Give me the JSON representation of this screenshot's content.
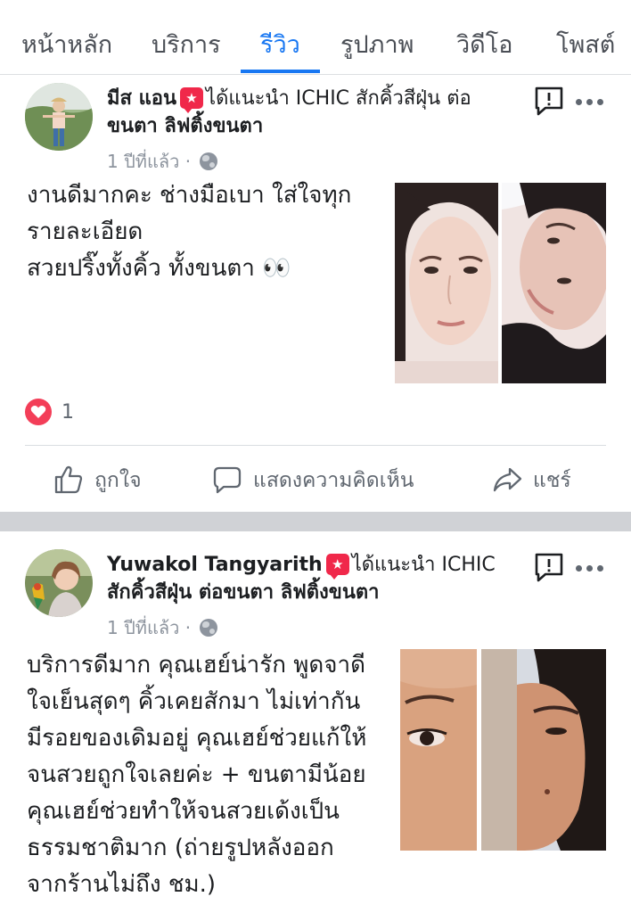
{
  "tabs": [
    {
      "label": "หน้าหลัก",
      "active": false
    },
    {
      "label": "บริการ",
      "active": false
    },
    {
      "label": "รีวิว",
      "active": true
    },
    {
      "label": "รูปภาพ",
      "active": false
    },
    {
      "label": "วิดีโอ",
      "active": false
    },
    {
      "label": "โพสต์",
      "active": false
    }
  ],
  "posts": [
    {
      "author": "มีส แอน",
      "recommend_line1": "ได้แนะนำ ICHIC สักคิ้วสีฝุ่น ต่อ",
      "recommend_line2": "ขนตา ลิฟติ้งขนตา",
      "time": "1 ปีที่แล้ว ·",
      "text_lines": [
        "งานดีมากคะ ช่างมือเบา ใส่ใจทุก",
        "รายละเอียด",
        "สวยปริ๊งทั้งคิ้ว ทั้งขนตา 👀"
      ],
      "reaction_count": "1",
      "actions": {
        "like": "ถูกใจ",
        "comment": "แสดงความคิดเห็น",
        "share": "แชร์"
      }
    },
    {
      "author": "Yuwakol Tangyarith",
      "recommend_line1": "ได้แนะนำ ICHIC",
      "recommend_line2": "สักคิ้วสีฝุ่น ต่อขนตา ลิฟติ้งขนตา",
      "time": "1 ปีที่แล้ว ·",
      "text_lines": [
        "บริการดีมาก คุณเฮย์น่ารัก พูดจาดี",
        "ใจเย็นสุดๆ คิ้วเคยสักมา ไม่เท่ากัน",
        "มีรอยของเดิมอยู่ คุณเฮย์ช่วยแก้ให้",
        "จนสวยถูกใจเลยค่ะ + ขนตามีน้อย",
        "คุณเฮย์ช่วยทำให้จนสวยเด้งเป็น",
        "ธรรมชาติมาก  (ถ่ายรูปหลังออก",
        "จากร้านไม่ถึง ชม.)"
      ]
    }
  ],
  "colors": {
    "accent": "#1877f2",
    "badge": "#f0284a",
    "heart": "#f33e58",
    "separator": "#d0d2d6"
  }
}
